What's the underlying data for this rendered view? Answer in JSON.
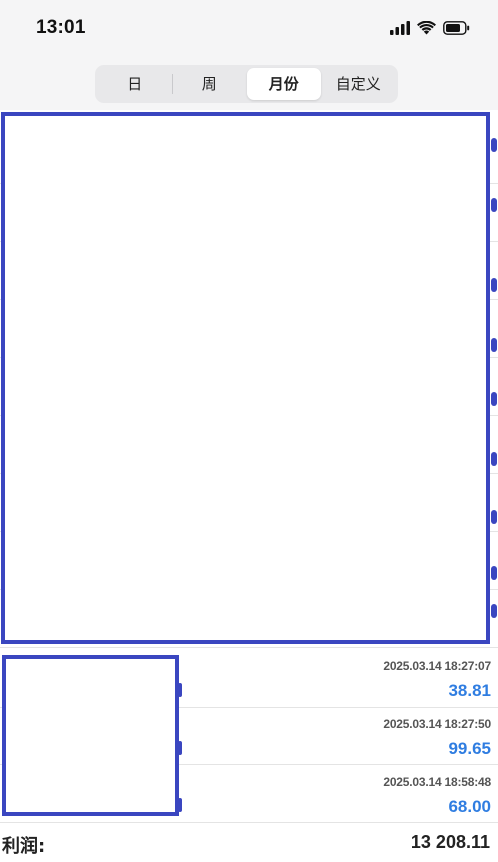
{
  "status": {
    "time": "13:01"
  },
  "period_tabs": [
    {
      "label": "日",
      "active": false
    },
    {
      "label": "周",
      "active": false
    },
    {
      "label": "月份",
      "active": true
    },
    {
      "label": "自定义",
      "active": false
    }
  ],
  "transactions": [
    {
      "timestamp": "2025.03.14 18:27:07",
      "amount": "38.81"
    },
    {
      "timestamp": "2025.03.14 18:27:50",
      "amount": "99.65"
    },
    {
      "timestamp": "2025.03.14 18:58:48",
      "amount": "68.00"
    }
  ],
  "summary": {
    "profit_label": "利润:",
    "profit_value": "13 208.11"
  },
  "colors": {
    "accent": "#2f7de1",
    "redaction": "#3a46c0"
  }
}
